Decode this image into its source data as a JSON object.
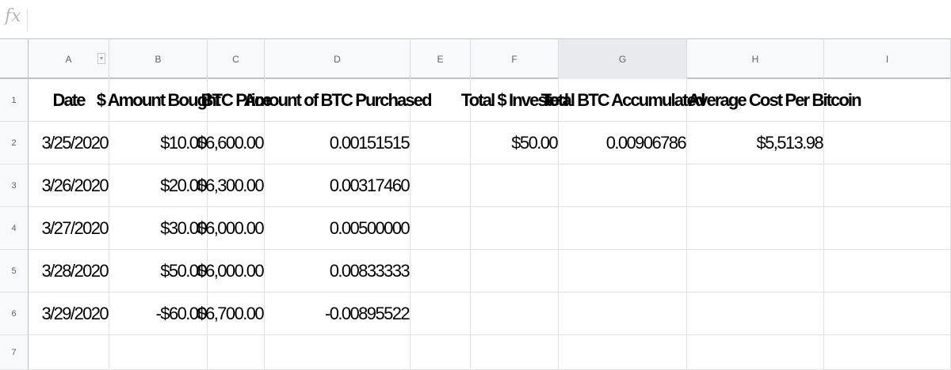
{
  "formula_bar": {
    "icon_label": "fx",
    "value": ""
  },
  "columns": [
    "A",
    "B",
    "C",
    "D",
    "E",
    "F",
    "G",
    "H",
    "I"
  ],
  "rows": [
    "1",
    "2",
    "3",
    "4",
    "5",
    "6",
    "7"
  ],
  "cells": {
    "r1": {
      "a": "Date",
      "b": "$ Amount Bought",
      "c": "BTC Price",
      "d": "Amount of BTC Purchased",
      "f": "Total $ Invested",
      "g": "Total BTC Accumulated",
      "h": "Average Cost Per Bitcoin"
    },
    "r2": {
      "a": "3/25/2020",
      "b": "$10.00",
      "c": "$6,600.00",
      "d": "0.00151515",
      "f": "$50.00",
      "g": "0.00906786",
      "h": "$5,513.98"
    },
    "r3": {
      "a": "3/26/2020",
      "b": "$20.00",
      "c": "$6,300.00",
      "d": "0.00317460"
    },
    "r4": {
      "a": "3/27/2020",
      "b": "$30.00",
      "c": "$6,000.00",
      "d": "0.00500000"
    },
    "r5": {
      "a": "3/28/2020",
      "b": "$50.00",
      "c": "$6,000.00",
      "d": "0.00833333"
    },
    "r6": {
      "a": "3/29/2020",
      "b": "-$60.00",
      "c": "$6,700.00",
      "d": "-0.00895522"
    }
  },
  "selected_column": "G",
  "colors": {
    "header_bg": "#f8f9fa",
    "selected_header_bg": "#e8eaed",
    "gridline": "#e2e2e2"
  }
}
